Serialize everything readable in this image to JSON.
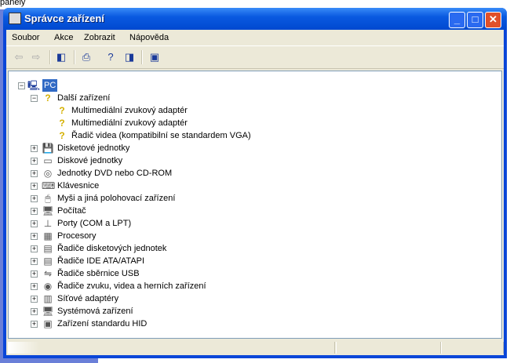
{
  "background": {
    "text": "panely"
  },
  "window": {
    "title": "Správce zařízení"
  },
  "menu": [
    "Soubor",
    "Akce",
    "Zobrazit",
    "Nápověda"
  ],
  "toolbar": [
    {
      "name": "back-icon",
      "glyph": "⇦"
    },
    {
      "name": "forward-icon",
      "glyph": "⇨"
    },
    {
      "name": "show-hide-tree-icon",
      "glyph": "◧"
    },
    {
      "name": "print-icon",
      "glyph": "⎙"
    },
    {
      "name": "properties-help-icon",
      "glyph": "?"
    },
    {
      "name": "action-pane-icon",
      "glyph": "◨"
    },
    {
      "name": "scan-hardware-icon",
      "glyph": "▣"
    }
  ],
  "tree": {
    "root": "PC",
    "other": {
      "label": "Další zařízení",
      "children": [
        "Multimediální zvukový adaptér",
        "Multimediální zvukový adaptér",
        "Řadič videa (kompatibilní se standardem VGA)"
      ]
    },
    "categories": [
      "Disketové jednotky",
      "Diskové jednotky",
      "Jednotky DVD nebo CD-ROM",
      "Klávesnice",
      "Myši a jiná polohovací zařízení",
      "Počítač",
      "Porty (COM a LPT)",
      "Procesory",
      "Řadiče disketových jednotek",
      "Řadiče IDE ATA/ATAPI",
      "Řadiče sběrnice USB",
      "Řadiče zvuku, videa a herních zařízení",
      "Síťové adaptéry",
      "Systémová zařízení",
      "Zařízení standardu HID"
    ]
  }
}
